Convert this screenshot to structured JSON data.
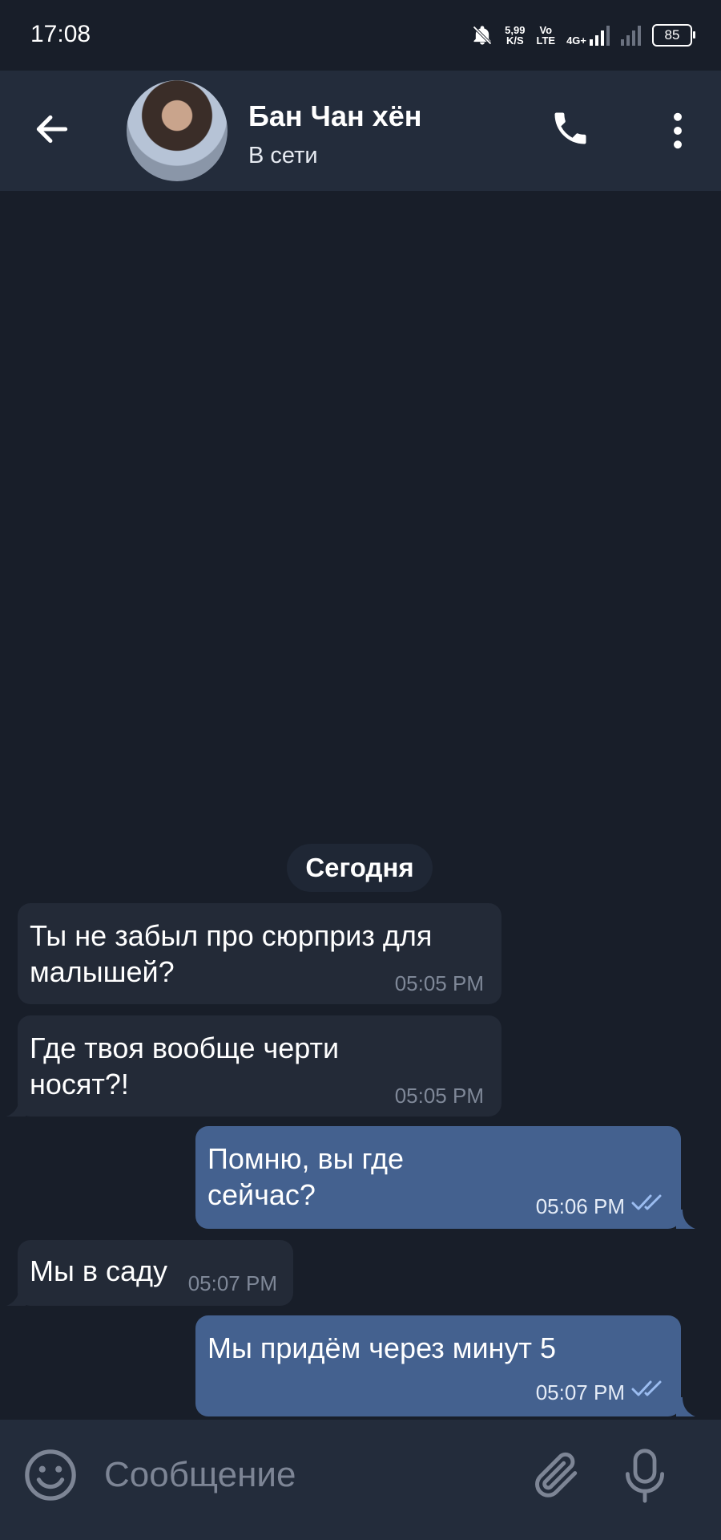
{
  "status_bar": {
    "time": "17:08",
    "speed_value": "5,99",
    "speed_unit": "K/S",
    "volte_top": "Vo",
    "volte_bottom": "LTE",
    "network": "4G+",
    "battery": "85"
  },
  "header": {
    "contact_name": "Бан Чан хён",
    "presence": "В сети"
  },
  "chat": {
    "date_separator": "Сегодня",
    "messages": [
      {
        "direction": "in",
        "text_line1": "Ты не забыл про сюрприз для",
        "text_line2": "малышей?",
        "time": "05:05 PM"
      },
      {
        "direction": "in",
        "text_line1": "Где твоя вообще черти",
        "text_line2": "носят?!",
        "time": "05:05 PM"
      },
      {
        "direction": "out",
        "text_line1": "Помню, вы где",
        "text_line2": "сейчас?",
        "time": "05:06 PM",
        "status": "read"
      },
      {
        "direction": "in",
        "text_line1": "Мы в саду",
        "time": "05:07 PM"
      },
      {
        "direction": "out",
        "text_line1": "Мы придём через минут 5",
        "time": "05:07 PM",
        "status": "read"
      }
    ]
  },
  "composer": {
    "placeholder": "Сообщение"
  },
  "icons": {
    "back": "arrow-left-icon",
    "call": "phone-icon",
    "more": "more-vertical-icon",
    "emoji": "smiley-icon",
    "attach": "paperclip-icon",
    "mic": "microphone-icon",
    "read": "double-check-icon",
    "mute": "bell-off-icon"
  },
  "colors": {
    "background": "#181e29",
    "header": "#232c3b",
    "incoming_bubble": "#232a37",
    "outgoing_bubble": "#44618f",
    "check_color": "#9bbcf0"
  }
}
